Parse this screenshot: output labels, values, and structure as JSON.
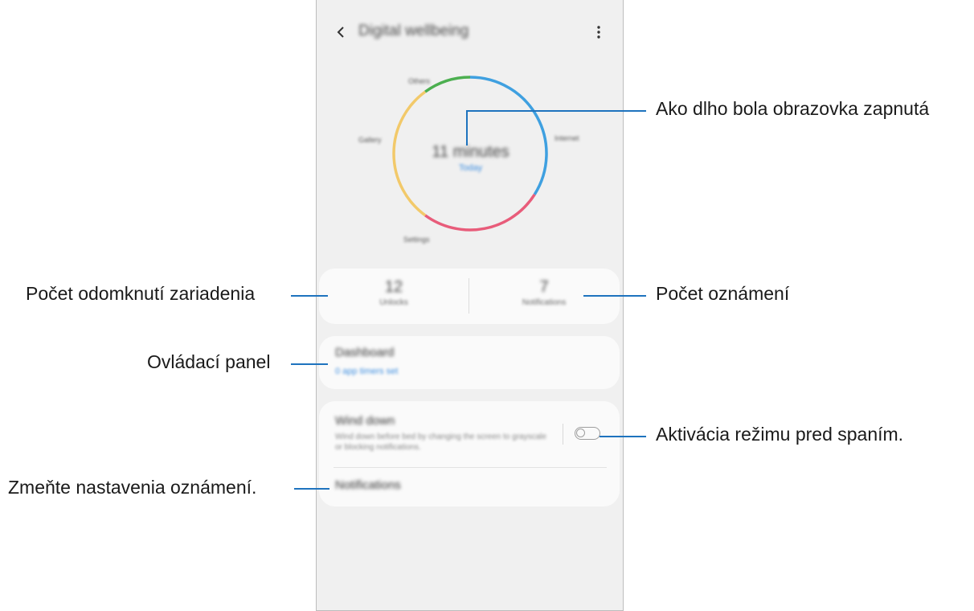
{
  "app": {
    "title": "Digital wellbeing"
  },
  "usage_ring": {
    "center_value": "11 minutes",
    "center_sub": "Today",
    "labels": [
      "Others",
      "Gallery",
      "Internet",
      "Settings"
    ],
    "segments": [
      {
        "color": "#3fa0e0",
        "share": 0.34
      },
      {
        "color": "#e85c7a",
        "share": 0.26
      },
      {
        "color": "#f2c96a",
        "share": 0.3
      },
      {
        "color": "#4caf50",
        "share": 0.1
      }
    ]
  },
  "stats": {
    "unlocks_value": "12",
    "unlocks_label": "Unlocks",
    "notifications_value": "7",
    "notifications_label": "Notifications"
  },
  "dashboard": {
    "title": "Dashboard",
    "subtitle": "0 app timers set"
  },
  "wind_down": {
    "title": "Wind down",
    "description": "Wind down before bed by changing the screen to grayscale or blocking notifications.",
    "toggle_on": false
  },
  "notifications_item": {
    "title": "Notifications"
  },
  "callouts": {
    "screen_time": "Ako dlho bola obrazovka zapnutá",
    "unlocks": "Počet odomknutí zariadenia",
    "notifications_count": "Počet oznámení",
    "dashboard": "Ovládací panel",
    "wind_down": "Aktivácia režimu pred spaním.",
    "notification_settings": "Zmeňte nastavenia oznámení."
  },
  "colors": {
    "leader_line": "#1e73be",
    "accent_blue": "#3fa0e0"
  }
}
